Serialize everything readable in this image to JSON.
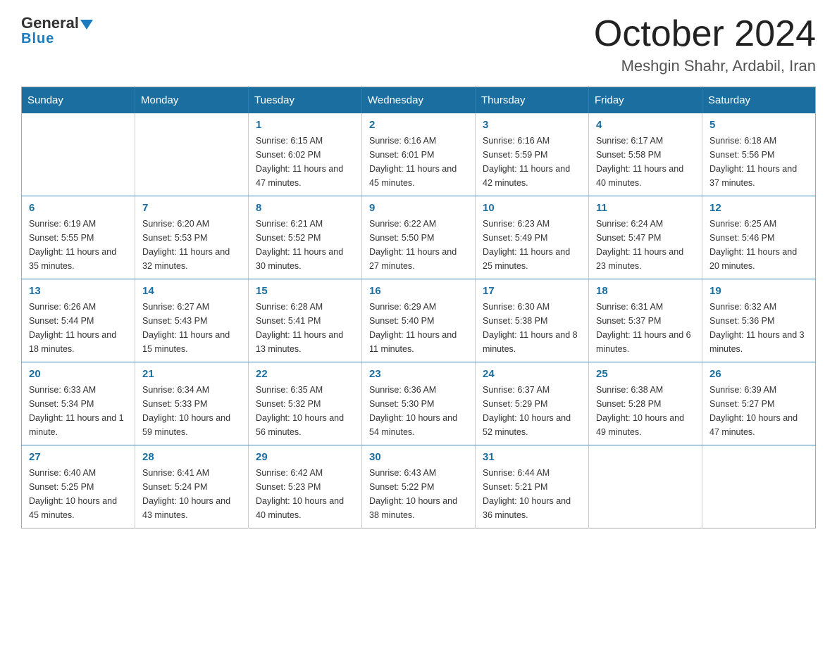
{
  "logo": {
    "general": "General",
    "triangle": "",
    "blue": "Blue"
  },
  "title": "October 2024",
  "location": "Meshgin Shahr, Ardabil, Iran",
  "weekdays": [
    "Sunday",
    "Monday",
    "Tuesday",
    "Wednesday",
    "Thursday",
    "Friday",
    "Saturday"
  ],
  "weeks": [
    [
      {
        "day": "",
        "sunrise": "",
        "sunset": "",
        "daylight": ""
      },
      {
        "day": "",
        "sunrise": "",
        "sunset": "",
        "daylight": ""
      },
      {
        "day": "1",
        "sunrise": "Sunrise: 6:15 AM",
        "sunset": "Sunset: 6:02 PM",
        "daylight": "Daylight: 11 hours and 47 minutes."
      },
      {
        "day": "2",
        "sunrise": "Sunrise: 6:16 AM",
        "sunset": "Sunset: 6:01 PM",
        "daylight": "Daylight: 11 hours and 45 minutes."
      },
      {
        "day": "3",
        "sunrise": "Sunrise: 6:16 AM",
        "sunset": "Sunset: 5:59 PM",
        "daylight": "Daylight: 11 hours and 42 minutes."
      },
      {
        "day": "4",
        "sunrise": "Sunrise: 6:17 AM",
        "sunset": "Sunset: 5:58 PM",
        "daylight": "Daylight: 11 hours and 40 minutes."
      },
      {
        "day": "5",
        "sunrise": "Sunrise: 6:18 AM",
        "sunset": "Sunset: 5:56 PM",
        "daylight": "Daylight: 11 hours and 37 minutes."
      }
    ],
    [
      {
        "day": "6",
        "sunrise": "Sunrise: 6:19 AM",
        "sunset": "Sunset: 5:55 PM",
        "daylight": "Daylight: 11 hours and 35 minutes."
      },
      {
        "day": "7",
        "sunrise": "Sunrise: 6:20 AM",
        "sunset": "Sunset: 5:53 PM",
        "daylight": "Daylight: 11 hours and 32 minutes."
      },
      {
        "day": "8",
        "sunrise": "Sunrise: 6:21 AM",
        "sunset": "Sunset: 5:52 PM",
        "daylight": "Daylight: 11 hours and 30 minutes."
      },
      {
        "day": "9",
        "sunrise": "Sunrise: 6:22 AM",
        "sunset": "Sunset: 5:50 PM",
        "daylight": "Daylight: 11 hours and 27 minutes."
      },
      {
        "day": "10",
        "sunrise": "Sunrise: 6:23 AM",
        "sunset": "Sunset: 5:49 PM",
        "daylight": "Daylight: 11 hours and 25 minutes."
      },
      {
        "day": "11",
        "sunrise": "Sunrise: 6:24 AM",
        "sunset": "Sunset: 5:47 PM",
        "daylight": "Daylight: 11 hours and 23 minutes."
      },
      {
        "day": "12",
        "sunrise": "Sunrise: 6:25 AM",
        "sunset": "Sunset: 5:46 PM",
        "daylight": "Daylight: 11 hours and 20 minutes."
      }
    ],
    [
      {
        "day": "13",
        "sunrise": "Sunrise: 6:26 AM",
        "sunset": "Sunset: 5:44 PM",
        "daylight": "Daylight: 11 hours and 18 minutes."
      },
      {
        "day": "14",
        "sunrise": "Sunrise: 6:27 AM",
        "sunset": "Sunset: 5:43 PM",
        "daylight": "Daylight: 11 hours and 15 minutes."
      },
      {
        "day": "15",
        "sunrise": "Sunrise: 6:28 AM",
        "sunset": "Sunset: 5:41 PM",
        "daylight": "Daylight: 11 hours and 13 minutes."
      },
      {
        "day": "16",
        "sunrise": "Sunrise: 6:29 AM",
        "sunset": "Sunset: 5:40 PM",
        "daylight": "Daylight: 11 hours and 11 minutes."
      },
      {
        "day": "17",
        "sunrise": "Sunrise: 6:30 AM",
        "sunset": "Sunset: 5:38 PM",
        "daylight": "Daylight: 11 hours and 8 minutes."
      },
      {
        "day": "18",
        "sunrise": "Sunrise: 6:31 AM",
        "sunset": "Sunset: 5:37 PM",
        "daylight": "Daylight: 11 hours and 6 minutes."
      },
      {
        "day": "19",
        "sunrise": "Sunrise: 6:32 AM",
        "sunset": "Sunset: 5:36 PM",
        "daylight": "Daylight: 11 hours and 3 minutes."
      }
    ],
    [
      {
        "day": "20",
        "sunrise": "Sunrise: 6:33 AM",
        "sunset": "Sunset: 5:34 PM",
        "daylight": "Daylight: 11 hours and 1 minute."
      },
      {
        "day": "21",
        "sunrise": "Sunrise: 6:34 AM",
        "sunset": "Sunset: 5:33 PM",
        "daylight": "Daylight: 10 hours and 59 minutes."
      },
      {
        "day": "22",
        "sunrise": "Sunrise: 6:35 AM",
        "sunset": "Sunset: 5:32 PM",
        "daylight": "Daylight: 10 hours and 56 minutes."
      },
      {
        "day": "23",
        "sunrise": "Sunrise: 6:36 AM",
        "sunset": "Sunset: 5:30 PM",
        "daylight": "Daylight: 10 hours and 54 minutes."
      },
      {
        "day": "24",
        "sunrise": "Sunrise: 6:37 AM",
        "sunset": "Sunset: 5:29 PM",
        "daylight": "Daylight: 10 hours and 52 minutes."
      },
      {
        "day": "25",
        "sunrise": "Sunrise: 6:38 AM",
        "sunset": "Sunset: 5:28 PM",
        "daylight": "Daylight: 10 hours and 49 minutes."
      },
      {
        "day": "26",
        "sunrise": "Sunrise: 6:39 AM",
        "sunset": "Sunset: 5:27 PM",
        "daylight": "Daylight: 10 hours and 47 minutes."
      }
    ],
    [
      {
        "day": "27",
        "sunrise": "Sunrise: 6:40 AM",
        "sunset": "Sunset: 5:25 PM",
        "daylight": "Daylight: 10 hours and 45 minutes."
      },
      {
        "day": "28",
        "sunrise": "Sunrise: 6:41 AM",
        "sunset": "Sunset: 5:24 PM",
        "daylight": "Daylight: 10 hours and 43 minutes."
      },
      {
        "day": "29",
        "sunrise": "Sunrise: 6:42 AM",
        "sunset": "Sunset: 5:23 PM",
        "daylight": "Daylight: 10 hours and 40 minutes."
      },
      {
        "day": "30",
        "sunrise": "Sunrise: 6:43 AM",
        "sunset": "Sunset: 5:22 PM",
        "daylight": "Daylight: 10 hours and 38 minutes."
      },
      {
        "day": "31",
        "sunrise": "Sunrise: 6:44 AM",
        "sunset": "Sunset: 5:21 PM",
        "daylight": "Daylight: 10 hours and 36 minutes."
      },
      {
        "day": "",
        "sunrise": "",
        "sunset": "",
        "daylight": ""
      },
      {
        "day": "",
        "sunrise": "",
        "sunset": "",
        "daylight": ""
      }
    ]
  ]
}
